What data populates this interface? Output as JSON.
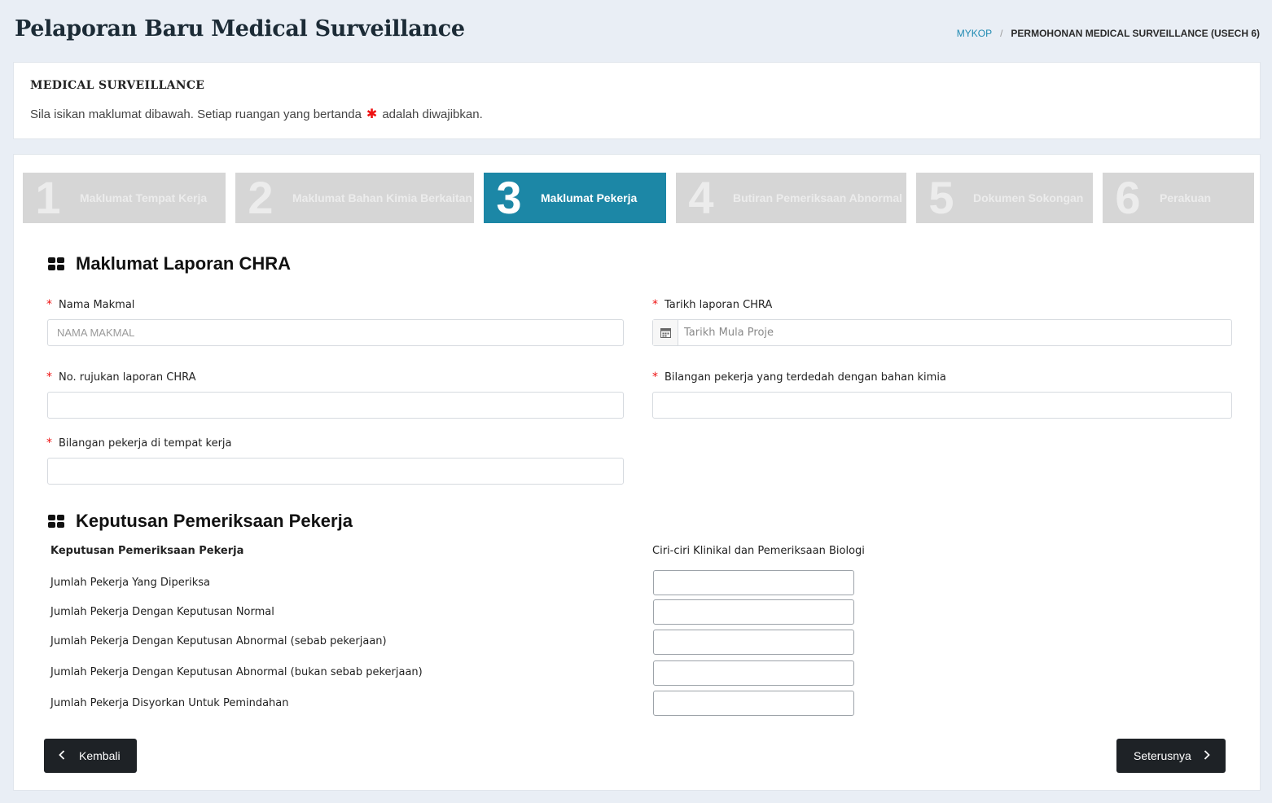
{
  "header": {
    "title": "Pelaporan Baru Medical Surveillance",
    "breadcrumb": [
      "MYKOP",
      "PERMOHONAN MEDICAL SURVEILLANCE (USECH 6)"
    ]
  },
  "intro": {
    "title": "MEDICAL SURVEILLANCE",
    "text_before": "Sila isikan maklumat dibawah. Setiap ruangan yang bertanda",
    "text_after": "adalah diwajibkan."
  },
  "steps": [
    {
      "num": "1",
      "label": "Maklumat Tempat Kerja",
      "active": false
    },
    {
      "num": "2",
      "label": "Maklumat Bahan Kimia Berkaitan",
      "active": false
    },
    {
      "num": "3",
      "label": "Maklumat Pekerja",
      "active": true
    },
    {
      "num": "4",
      "label": "Butiran Pemeriksaan Abnormal",
      "active": false
    },
    {
      "num": "5",
      "label": "Dokumen Sokongan",
      "active": false
    },
    {
      "num": "6",
      "label": "Perakuan",
      "active": false
    }
  ],
  "section1": {
    "heading": "Maklumat Laporan CHRA",
    "fields": {
      "nama_makmal": {
        "label": "Nama Makmal",
        "placeholder": "NAMA MAKMAL",
        "value": ""
      },
      "tarikh": {
        "label": "Tarikh laporan CHRA",
        "placeholder": "Tarikh Mula Proje",
        "value": ""
      },
      "no_rujukan": {
        "label": "No. rujukan laporan CHRA",
        "placeholder": "",
        "value": ""
      },
      "bilangan_terdedah": {
        "label": "Bilangan pekerja yang terdedah dengan bahan kimia",
        "placeholder": "",
        "value": ""
      },
      "bilangan_tempat": {
        "label": "Bilangan pekerja di tempat kerja",
        "placeholder": "",
        "value": ""
      }
    }
  },
  "section2": {
    "heading": "Keputusan Pemeriksaan Pekerja",
    "col_left": "Keputusan Pemeriksaan Pekerja",
    "col_right": "Ciri-ciri Klinikal dan Pemeriksaan Biologi",
    "rows": [
      {
        "label": "Jumlah Pekerja Yang Diperiksa",
        "value": ""
      },
      {
        "label": "Jumlah Pekerja Dengan Keputusan Normal",
        "value": ""
      },
      {
        "label": "Jumlah Pekerja Dengan Keputusan Abnormal (sebab pekerjaan)",
        "value": ""
      },
      {
        "label": "Jumlah Pekerja Dengan Keputusan Abnormal (bukan sebab pekerjaan)",
        "value": ""
      },
      {
        "label": "Jumlah Pekerja Disyorkan Untuk Pemindahan",
        "value": ""
      }
    ]
  },
  "buttons": {
    "back": "Kembali",
    "next": "Seterusnya"
  },
  "colors": {
    "accent": "#1c87a6",
    "required": "#e11111",
    "step_inactive": "#d6d6d6",
    "button_dark": "#1e2226"
  },
  "icons": {
    "section": "grid-icon",
    "date": "calendar-icon",
    "back": "chevron-left-icon",
    "next": "chevron-right-icon",
    "required": "asterisk-icon"
  }
}
